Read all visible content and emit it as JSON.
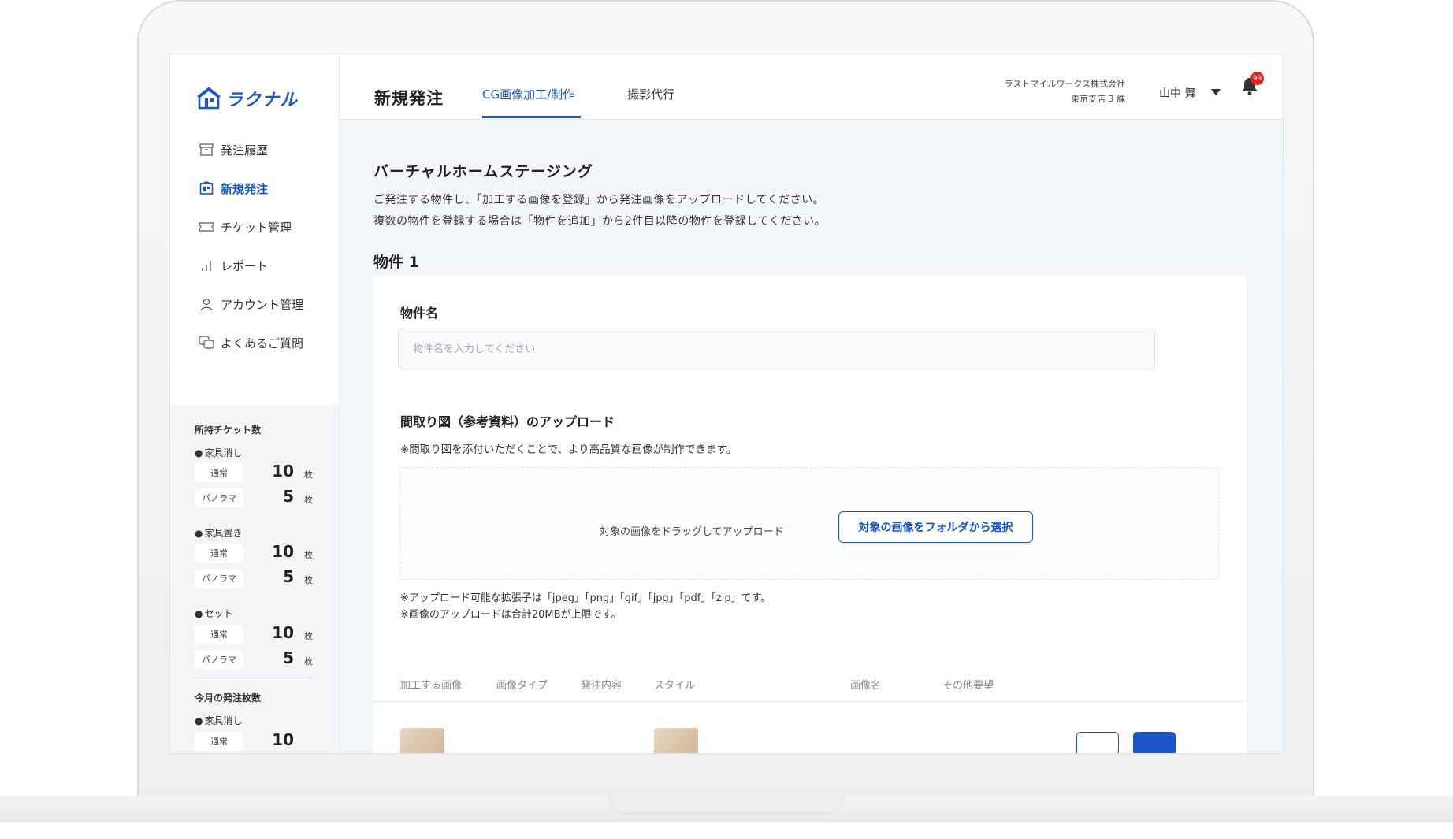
{
  "logo": {
    "text": "ラクナル"
  },
  "sidebar": {
    "items": [
      {
        "label": "発注履歴",
        "icon": "archive-box-icon",
        "active": false
      },
      {
        "label": "新規発注",
        "icon": "building-icon",
        "active": true
      },
      {
        "label": "チケット管理",
        "icon": "ticket-icon",
        "active": false
      },
      {
        "label": "レポート",
        "icon": "bar-chart-icon",
        "active": false
      },
      {
        "label": "アカウント管理",
        "icon": "user-icon",
        "active": false
      },
      {
        "label": "よくあるご質問",
        "icon": "chat-bubbles-icon",
        "active": false
      }
    ]
  },
  "tickets": {
    "title": "所持チケット数",
    "groups": [
      {
        "name": "家具消し",
        "rows": [
          {
            "type": "通常",
            "count": "10",
            "unit": "枚"
          },
          {
            "type": "パノラマ",
            "count": "5",
            "unit": "枚"
          }
        ]
      },
      {
        "name": "家具置き",
        "rows": [
          {
            "type": "通常",
            "count": "10",
            "unit": "枚"
          },
          {
            "type": "パノラマ",
            "count": "5",
            "unit": "枚"
          }
        ]
      },
      {
        "name": "セット",
        "rows": [
          {
            "type": "通常",
            "count": "10",
            "unit": "枚"
          },
          {
            "type": "パノラマ",
            "count": "5",
            "unit": "枚"
          }
        ]
      }
    ],
    "monthly_title": "今月の発注枚数",
    "monthly_group": "家具消し",
    "monthly_first_row": {
      "type": "通常",
      "count": "10"
    }
  },
  "header": {
    "title": "新規発注",
    "tabs": [
      {
        "label": "CG画像加工/制作",
        "active": true
      },
      {
        "label": "撮影代行",
        "active": false
      }
    ],
    "company": "ラストマイルワークス株式会社",
    "branch": "東京支店 3 課",
    "user": "山中 舞",
    "notification_count": "99"
  },
  "main": {
    "title": "バーチャルホームステージング",
    "desc1": "ご発注する物件し、「加工する画像を登録」から発注画像をアップロードしてください。",
    "desc2": "複数の物件を登録する場合は「物件を追加」から2件目以降の物件を登録してください。",
    "property_heading": "物件 1",
    "name_label": "物件名",
    "name_placeholder": "物件名を入力してください",
    "name_value": "",
    "floorplan_label": "間取り図（参考資料）のアップロード",
    "floorplan_note": "※間取り図を添付いただくことで、より高品質な画像が制作できます。",
    "dropzone_text": "対象の画像をドラッグしてアップロード",
    "select_button": "対象の画像をフォルダから選択",
    "ext_note": "※アップロード可能な拡張子は「jpeg」「png」「gif」「jpg」「pdf」「zip」です。",
    "size_note": "※画像のアップロードは合計20MBが上限です。",
    "table_headers": [
      "加工する画像",
      "画像タイプ",
      "発注内容",
      "スタイル",
      "画像名",
      "その他要望"
    ]
  },
  "colors": {
    "accent": "#1a56c9",
    "badge": "#e02424",
    "main_bg": "#f3f6f9"
  }
}
